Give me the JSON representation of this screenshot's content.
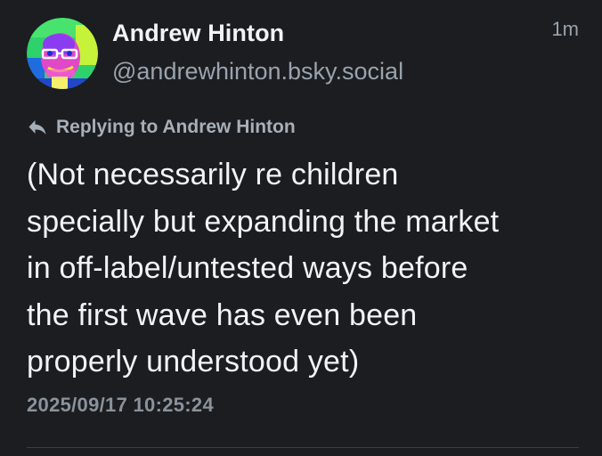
{
  "post": {
    "author": {
      "display_name": "Andrew Hinton",
      "handle": "@andrewhinton.bsky.social"
    },
    "relative_time": "1m",
    "reply_label": "Replying to Andrew Hinton",
    "text": "(Not necessarily re children\nspecially but expanding the market\nin off-label/untested ways before\nthe first wave has even been\nproperly understood yet)",
    "datetime": "2025/09/17 10:25:24"
  },
  "icons": {
    "avatar": "profile-photo",
    "reply": "reply-arrow-icon"
  },
  "colors": {
    "background": "#1b1d20",
    "text_primary": "#f1f3f5",
    "text_secondary": "#9aa3ad",
    "divider": "#3a3f45"
  }
}
